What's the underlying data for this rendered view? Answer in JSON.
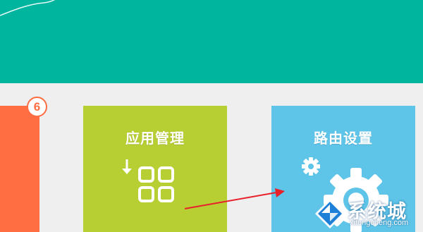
{
  "colors": {
    "header_bg": "#00b59e",
    "page_bg": "#efefef",
    "tile_orange": "#ff6d42",
    "tile_green": "#b8cf34",
    "tile_blue": "#5ec4e8",
    "arrow": "#e8202a"
  },
  "tiles": [
    {
      "id": "partial-left",
      "badge": "6"
    },
    {
      "id": "app-management",
      "title": "应用管理",
      "icon": "app-grid-download-icon"
    },
    {
      "id": "route-settings",
      "title": "路由设置",
      "icon": "gear-icon"
    }
  ],
  "watermark": {
    "brand": "系统城",
    "url": "xitongcheng.com",
    "icon": "diamond-logo-icon"
  }
}
